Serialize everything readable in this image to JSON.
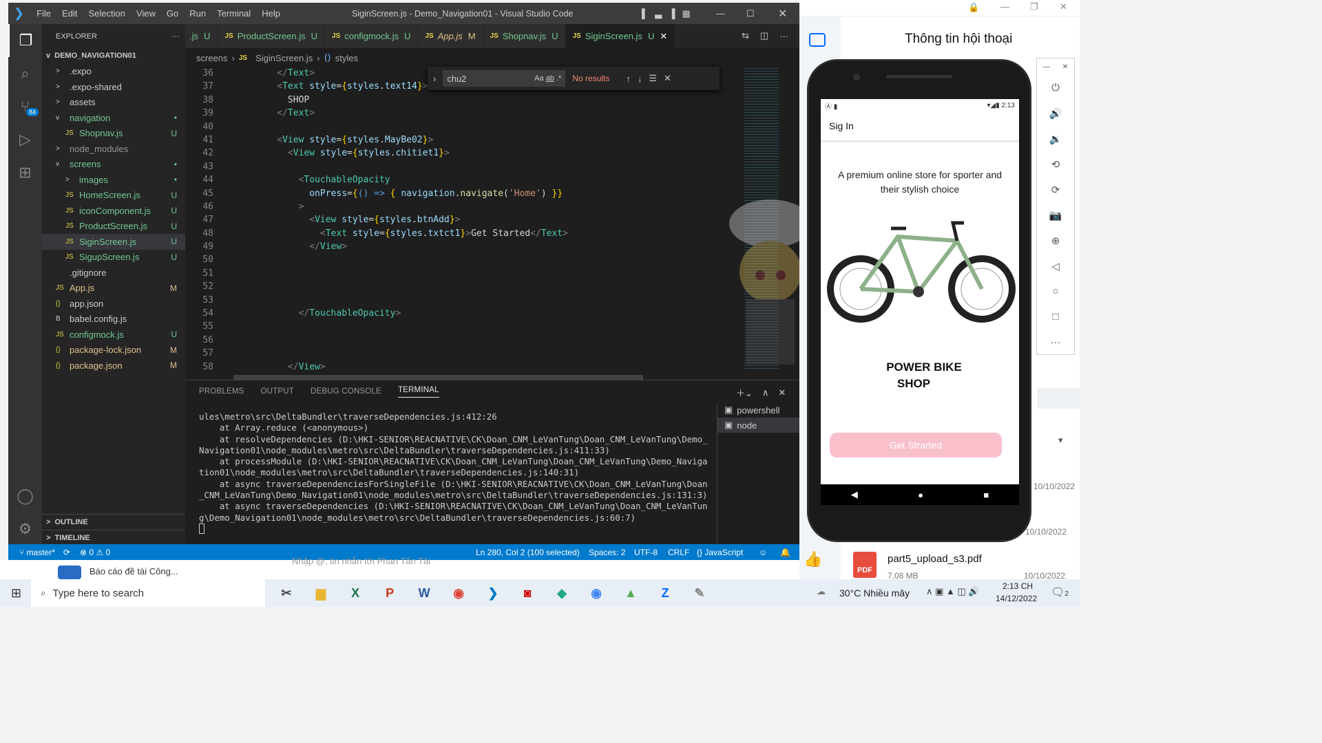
{
  "window": {
    "title": "SiginScreen.js - Demo_Navigation01 - Visual Studio Code",
    "menu": [
      "File",
      "Edit",
      "Selection",
      "View",
      "Go",
      "Run",
      "Terminal",
      "Help"
    ]
  },
  "sidebar": {
    "header": "EXPLORER",
    "root": "DEMO_NAVIGATION01",
    "items": [
      {
        "label": ".expo",
        "indent": 1,
        "chev": ">",
        "color": "#ccc",
        "status": ""
      },
      {
        "label": ".expo-shared",
        "indent": 1,
        "chev": ">",
        "color": "#ccc",
        "status": ""
      },
      {
        "label": "assets",
        "indent": 1,
        "chev": ">",
        "color": "#ccc",
        "status": ""
      },
      {
        "label": "navigation",
        "indent": 1,
        "chev": "v",
        "color": "#73c991",
        "status": "•"
      },
      {
        "label": "Shopnav.js",
        "indent": 2,
        "chev": "JS",
        "color": "#73c991",
        "status": "U"
      },
      {
        "label": "node_modules",
        "indent": 1,
        "chev": ">",
        "color": "#999",
        "status": ""
      },
      {
        "label": "screens",
        "indent": 1,
        "chev": "v",
        "color": "#73c991",
        "status": "•"
      },
      {
        "label": "images",
        "indent": 2,
        "chev": ">",
        "color": "#73c991",
        "status": "•"
      },
      {
        "label": "HomeScreen.js",
        "indent": 2,
        "chev": "JS",
        "color": "#73c991",
        "status": "U"
      },
      {
        "label": "iconComponent.js",
        "indent": 2,
        "chev": "JS",
        "color": "#73c991",
        "status": "U"
      },
      {
        "label": "ProductScreen.js",
        "indent": 2,
        "chev": "JS",
        "color": "#73c991",
        "status": "U"
      },
      {
        "label": "SiginScreen.js",
        "indent": 2,
        "chev": "JS",
        "color": "#73c991",
        "status": "U"
      },
      {
        "label": "SigupScreen.js",
        "indent": 2,
        "chev": "JS",
        "color": "#73c991",
        "status": "U"
      },
      {
        "label": ".gitignore",
        "indent": 1,
        "chev": "",
        "color": "#ccc",
        "status": ""
      },
      {
        "label": "App.js",
        "indent": 1,
        "chev": "JS",
        "color": "#e2c08d",
        "status": "M"
      },
      {
        "label": "app.json",
        "indent": 1,
        "chev": "{}",
        "color": "#ccc",
        "status": ""
      },
      {
        "label": "babel.config.js",
        "indent": 1,
        "chev": "B",
        "color": "#ccc",
        "status": ""
      },
      {
        "label": "configmock.js",
        "indent": 1,
        "chev": "JS",
        "color": "#73c991",
        "status": "U"
      },
      {
        "label": "package-lock.json",
        "indent": 1,
        "chev": "{}",
        "color": "#e2c08d",
        "status": "M"
      },
      {
        "label": "package.json",
        "indent": 1,
        "chev": "{}",
        "color": "#e2c08d",
        "status": "M"
      }
    ],
    "outline": "OUTLINE",
    "timeline": "TIMELINE"
  },
  "tabs": [
    {
      "label": ".js",
      "st": "U",
      "color": "#73c991"
    },
    {
      "label": "ProductScreen.js",
      "st": "U",
      "color": "#73c991"
    },
    {
      "label": "configmock.js",
      "st": "U",
      "color": "#73c991"
    },
    {
      "label": "App.js",
      "st": "M",
      "color": "#e2c08d"
    },
    {
      "label": "Shopnav.js",
      "st": "U",
      "color": "#73c991"
    },
    {
      "label": "SiginScreen.js",
      "st": "U",
      "color": "#73c991"
    }
  ],
  "breadcrumb": {
    "a": "screens",
    "b": "SiginScreen.js",
    "c": "styles"
  },
  "find": {
    "value": "chu2",
    "result": "No results"
  },
  "code": {
    "lines": [
      "36",
      "37",
      "38",
      "39",
      "40",
      "41",
      "42",
      "43",
      "44",
      "45",
      "46",
      "47",
      "48",
      "49",
      "50",
      "51",
      "52",
      "53",
      "54",
      "55",
      "56",
      "57",
      "58"
    ]
  },
  "panel": {
    "tabs": [
      "PROBLEMS",
      "OUTPUT",
      "DEBUG CONSOLE",
      "TERMINAL"
    ],
    "terminals": [
      "powershell",
      "node"
    ],
    "output": "ules\\metro\\src\\DeltaBundler\\traverseDependencies.js:412:26\n    at Array.reduce (<anonymous>)\n    at resolveDependencies (D:\\HKI-SENIOR\\REACNATIVE\\CK\\Doan_CNM_LeVanTung\\Doan_CNM_LeVanTung\\Demo_\nNavigation01\\node_modules\\metro\\src\\DeltaBundler\\traverseDependencies.js:411:33)\n    at processModule (D:\\HKI-SENIOR\\REACNATIVE\\CK\\Doan_CNM_LeVanTung\\Doan_CNM_LeVanTung\\Demo_Naviga\ntion01\\node_modules\\metro\\src\\DeltaBundler\\traverseDependencies.js:140:31)\n    at async traverseDependenciesForSingleFile (D:\\HKI-SENIOR\\REACNATIVE\\CK\\Doan_CNM_LeVanTung\\Doan\n_CNM_LeVanTung\\Demo_Navigation01\\node_modules\\metro\\src\\DeltaBundler\\traverseDependencies.js:131:3)\n    at async traverseDependencies (D:\\HKI-SENIOR\\REACNATIVE\\CK\\Doan_CNM_LeVanTung\\Doan_CNM_LeVanTun\ng\\Demo_Navigation01\\node_modules\\metro\\src\\DeltaBundler\\traverseDependencies.js:60:7)"
  },
  "status": {
    "branch": "master*",
    "errors": "⊗ 0 ⚠ 0",
    "cursor": "Ln 280, Col 2 (100 selected)",
    "spaces": "Spaces: 2",
    "enc": "UTF-8",
    "eol": "CRLF",
    "lang": "{} JavaScript"
  },
  "chat": {
    "title": "Thông tin hội thoại",
    "file": "part5_upload_s3.pdf",
    "size": "7.08 MB",
    "date1": "10/10/2022",
    "date2": "10/10/2022",
    "date3": "10/10/2022",
    "behind": "Nhập @, tin nhắn tới Phan Tấn Tài",
    "doc": "Báo cáo đề tài Công..."
  },
  "app": {
    "time": "2:13",
    "header": "Sig In",
    "tagline": "A premium online store for sporter and their stylish choice",
    "shop1": "POWER BIKE",
    "shop2": "SHOP",
    "button": "Get Strarted"
  },
  "taskbar": {
    "search": "Type here to search",
    "weather": "30°C  Nhiều mây",
    "time": "2:13 CH",
    "date": "14/12/2022",
    "notif": "2"
  }
}
